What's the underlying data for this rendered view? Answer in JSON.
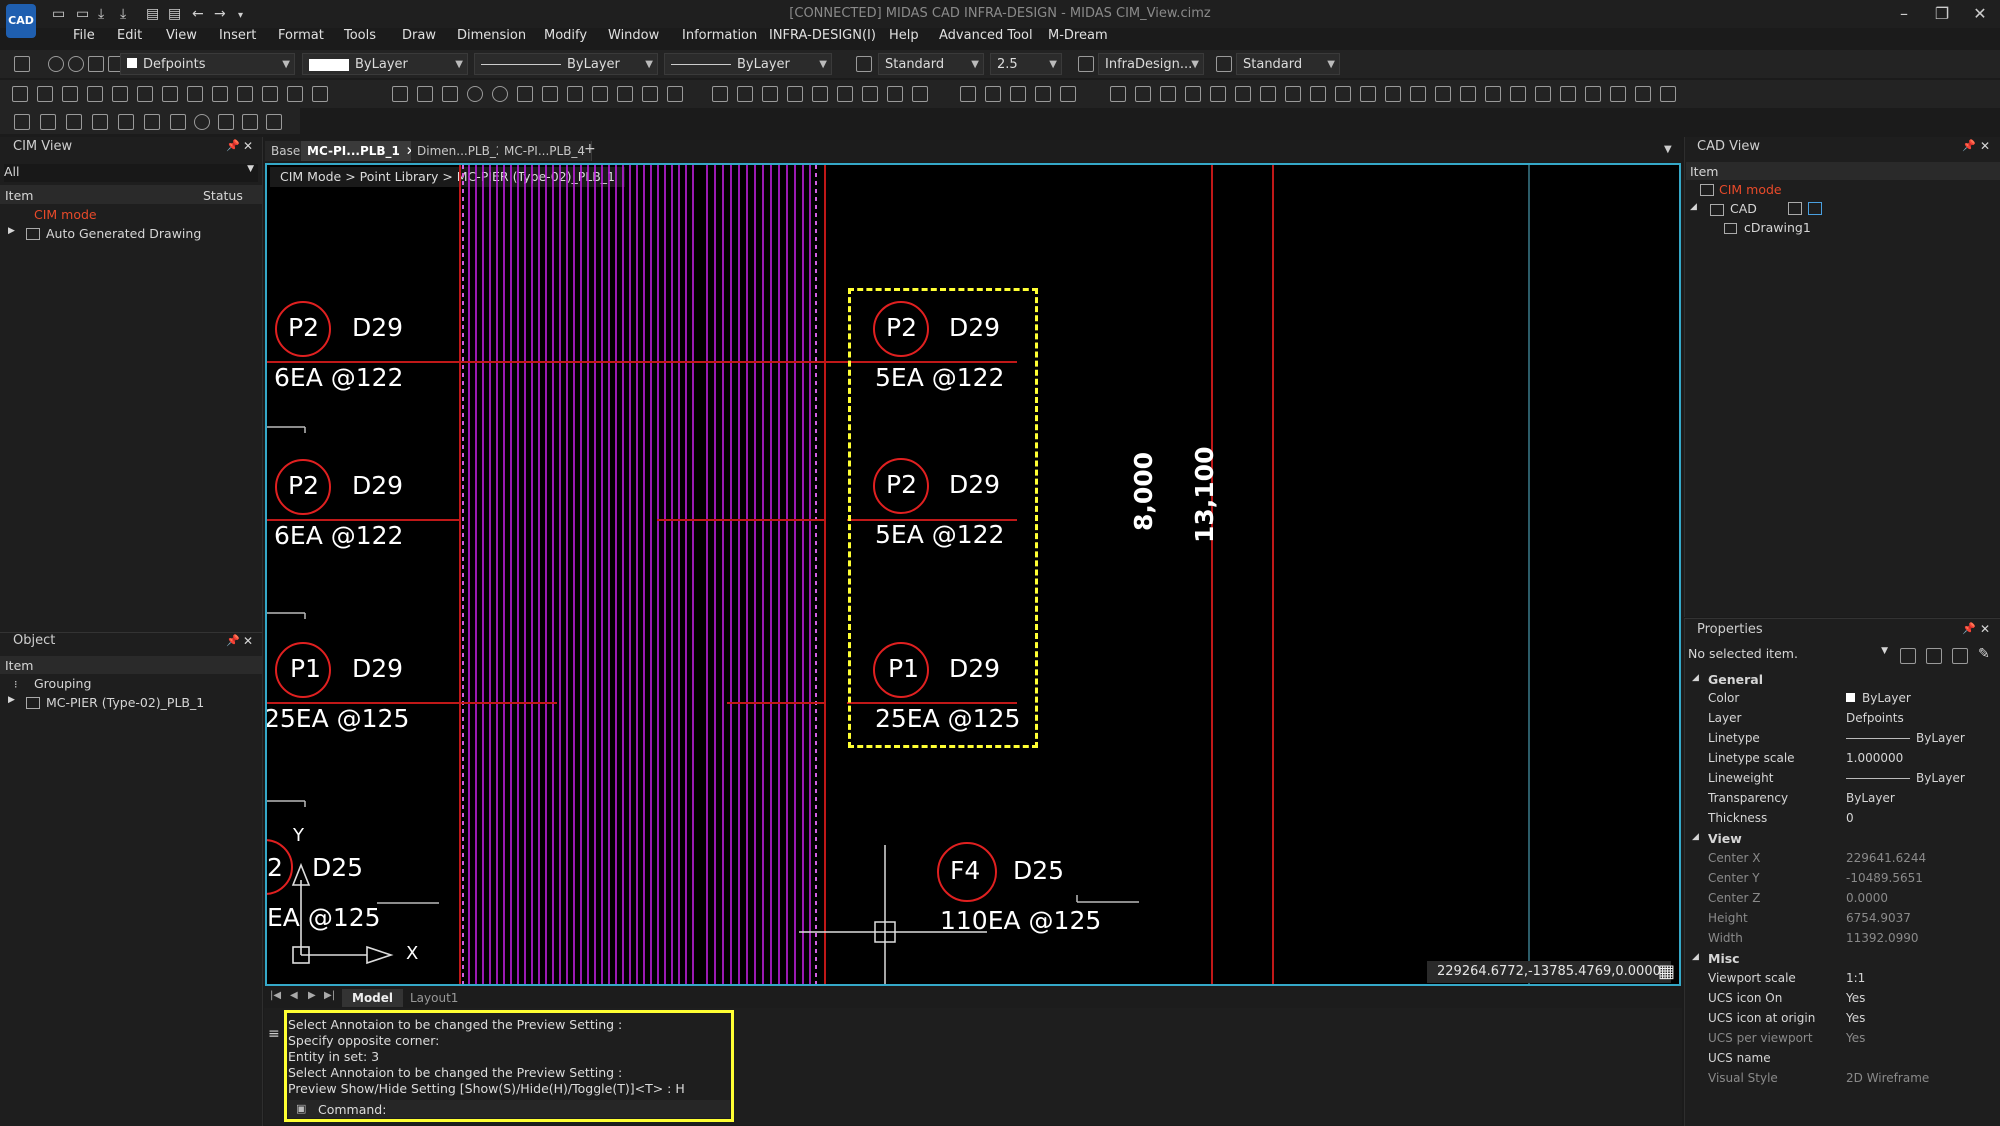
{
  "window": {
    "title": "[CONNECTED] MIDAS CAD INFRA-DESIGN - MIDAS CIM_View.cimz",
    "logo": "CAD"
  },
  "menu": [
    "File",
    "Edit",
    "View",
    "Insert",
    "Format",
    "Tools",
    "Draw",
    "Dimension",
    "Modify",
    "Window",
    "Information",
    "INFRA-DESIGN(I)",
    "Help",
    "Advanced Tool",
    "M-Dream"
  ],
  "toolbar1": {
    "layer": "Defpoints",
    "color": "ByLayer",
    "linetype": "ByLayer",
    "lineweight": "ByLayer",
    "text_style": "Standard",
    "text_height": "2.5",
    "dim_style": "InfraDesign...",
    "table_style": "Standard"
  },
  "cim_view": {
    "title": "CIM View",
    "filter": "All",
    "col_item": "Item",
    "col_status": "Status",
    "items": [
      "CIM mode",
      "Auto Generated Drawing"
    ]
  },
  "object_panel": {
    "title": "Object",
    "col_item": "Item",
    "items": [
      "Grouping",
      "MC-PIER (Type-02)_PLB_1"
    ]
  },
  "tabs": [
    "Base",
    "MC-PI...PLB_1",
    "Dimen...PLB_2",
    "MC-PI...PLB_4"
  ],
  "breadcrumb": "CIM Mode > Point Library > MC-PIER (Type-02)_PLB_1",
  "drawing": {
    "left_labels": [
      {
        "mark": "P2",
        "bar": "D29",
        "qty": "6EA @122"
      },
      {
        "mark": "P2",
        "bar": "D29",
        "qty": "6EA @122"
      },
      {
        "mark": "P1",
        "bar": "D29",
        "qty": "25EA @125"
      },
      {
        "mark": "2",
        "bar": "D25",
        "qty": "EA @125"
      }
    ],
    "right_labels": [
      {
        "mark": "P2",
        "bar": "D29",
        "qty": "5EA @122"
      },
      {
        "mark": "P2",
        "bar": "D29",
        "qty": "5EA @122"
      },
      {
        "mark": "P1",
        "bar": "D29",
        "qty": "25EA @125"
      }
    ],
    "f4": {
      "mark": "F4",
      "bar": "D25",
      "qty": "110EA @125"
    },
    "dim1": "8,000",
    "dim2": "13,100",
    "ucs_x": "X",
    "ucs_y": "Y"
  },
  "coords": "229264.6772,-13785.4769,0.0000",
  "layout_tabs": [
    "Model",
    "Layout1"
  ],
  "command": {
    "history": [
      "Select Annotaion to be changed the Preview Setting :",
      "Specify opposite corner:",
      "Entity in set: 3",
      "Select Annotaion to be changed the Preview Setting :",
      "Preview Show/Hide Setting [Show(S)/Hide(H)/Toggle(T)]<T> : H"
    ],
    "prompt": "Command:"
  },
  "cad_view": {
    "title": "CAD View",
    "col_item": "Item",
    "items": [
      "CIM mode",
      "CAD",
      "cDrawing1"
    ]
  },
  "properties": {
    "title": "Properties",
    "selection": "No selected item.",
    "groups": [
      {
        "name": "General",
        "rows": [
          {
            "k": "Color",
            "v": "ByLayer"
          },
          {
            "k": "Layer",
            "v": "Defpoints"
          },
          {
            "k": "Linetype",
            "v": "ByLayer"
          },
          {
            "k": "Linetype scale",
            "v": "1.000000"
          },
          {
            "k": "Lineweight",
            "v": "ByLayer"
          },
          {
            "k": "Transparency",
            "v": "ByLayer"
          },
          {
            "k": "Thickness",
            "v": "0"
          }
        ]
      },
      {
        "name": "View",
        "rows": [
          {
            "k": "Center X",
            "v": "229641.6244"
          },
          {
            "k": "Center Y",
            "v": "-10489.5651"
          },
          {
            "k": "Center Z",
            "v": "0.0000"
          },
          {
            "k": "Height",
            "v": "6754.9037"
          },
          {
            "k": "Width",
            "v": "11392.0990"
          }
        ]
      },
      {
        "name": "Misc",
        "rows": [
          {
            "k": "Viewport scale",
            "v": "1:1"
          },
          {
            "k": "UCS icon On",
            "v": "Yes"
          },
          {
            "k": "UCS icon at origin",
            "v": "Yes"
          },
          {
            "k": "UCS per viewport",
            "v": "Yes"
          },
          {
            "k": "UCS name",
            "v": ""
          },
          {
            "k": "Visual Style",
            "v": "2D Wireframe"
          }
        ]
      }
    ]
  },
  "colors": {
    "accent": "#35a8c8",
    "highlight": "#ffff33",
    "rebar": "#e02020",
    "mesh": "#c020e0",
    "cim_mode": "#e84a2a"
  }
}
